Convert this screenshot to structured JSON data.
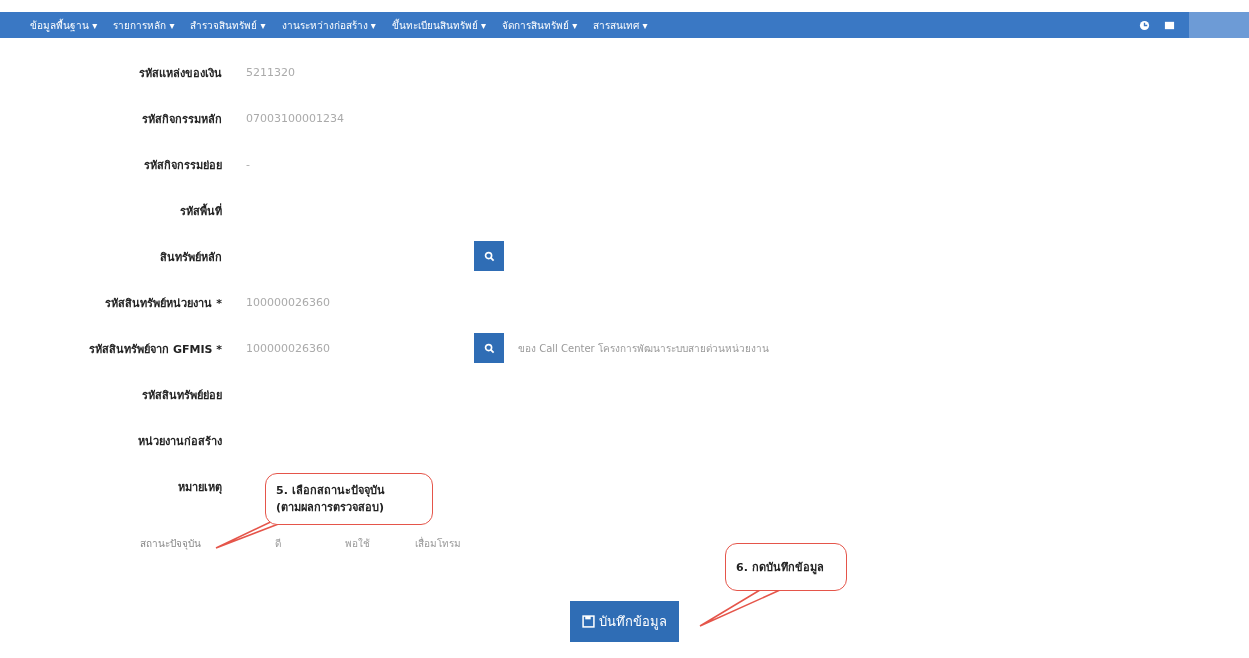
{
  "menu": [
    {
      "label": "ข้อมูลพื้นฐาน ▾"
    },
    {
      "label": "รายการหลัก ▾"
    },
    {
      "label": "สำรวจสินทรัพย์ ▾"
    },
    {
      "label": "งานระหว่างก่อสร้าง ▾"
    },
    {
      "label": "ขึ้นทะเบียนสินทรัพย์ ▾"
    },
    {
      "label": "จัดการสินทรัพย์ ▾"
    },
    {
      "label": "สารสนเทศ ▾"
    }
  ],
  "form": [
    {
      "label": "รหัสแหล่งของเงิน",
      "value": "5211320"
    },
    {
      "label": "รหัสกิจกรรมหลัก",
      "value": "07003100001234"
    },
    {
      "label": "รหัสกิจกรรมย่อย",
      "value": "-"
    },
    {
      "label": "รหัสพื้นที่"
    },
    {
      "label": "สินทรัพย์หลัก",
      "search": true
    },
    {
      "label": "รหัสสินทรัพย์หน่วยงาน *",
      "value": "100000026360"
    },
    {
      "label": "รหัสสินทรัพย์จาก GFMIS *",
      "value": "100000026360",
      "search": true,
      "note": "ของ Call Center โครงการพัฒนาระบบสายด่วนหน่วยงาน"
    },
    {
      "label": "รหัสสินทรัพย์ย่อย"
    },
    {
      "label": "หน่วยงานก่อสร้าง"
    },
    {
      "label": "หมายเหตุ"
    }
  ],
  "status": {
    "label": "สถานะปัจจุบัน",
    "options": [
      "ดี",
      "พอใช้",
      "เสื่อมโทรม"
    ]
  },
  "callouts": [
    {
      "lines": [
        "5. เลือกสถานะปัจจุบัน",
        "(ตามผลการตรวจสอบ)"
      ]
    },
    {
      "lines": [
        "6. กดบันทึกข้อมูล"
      ]
    }
  ],
  "save_button": "บันทึกข้อมูล"
}
